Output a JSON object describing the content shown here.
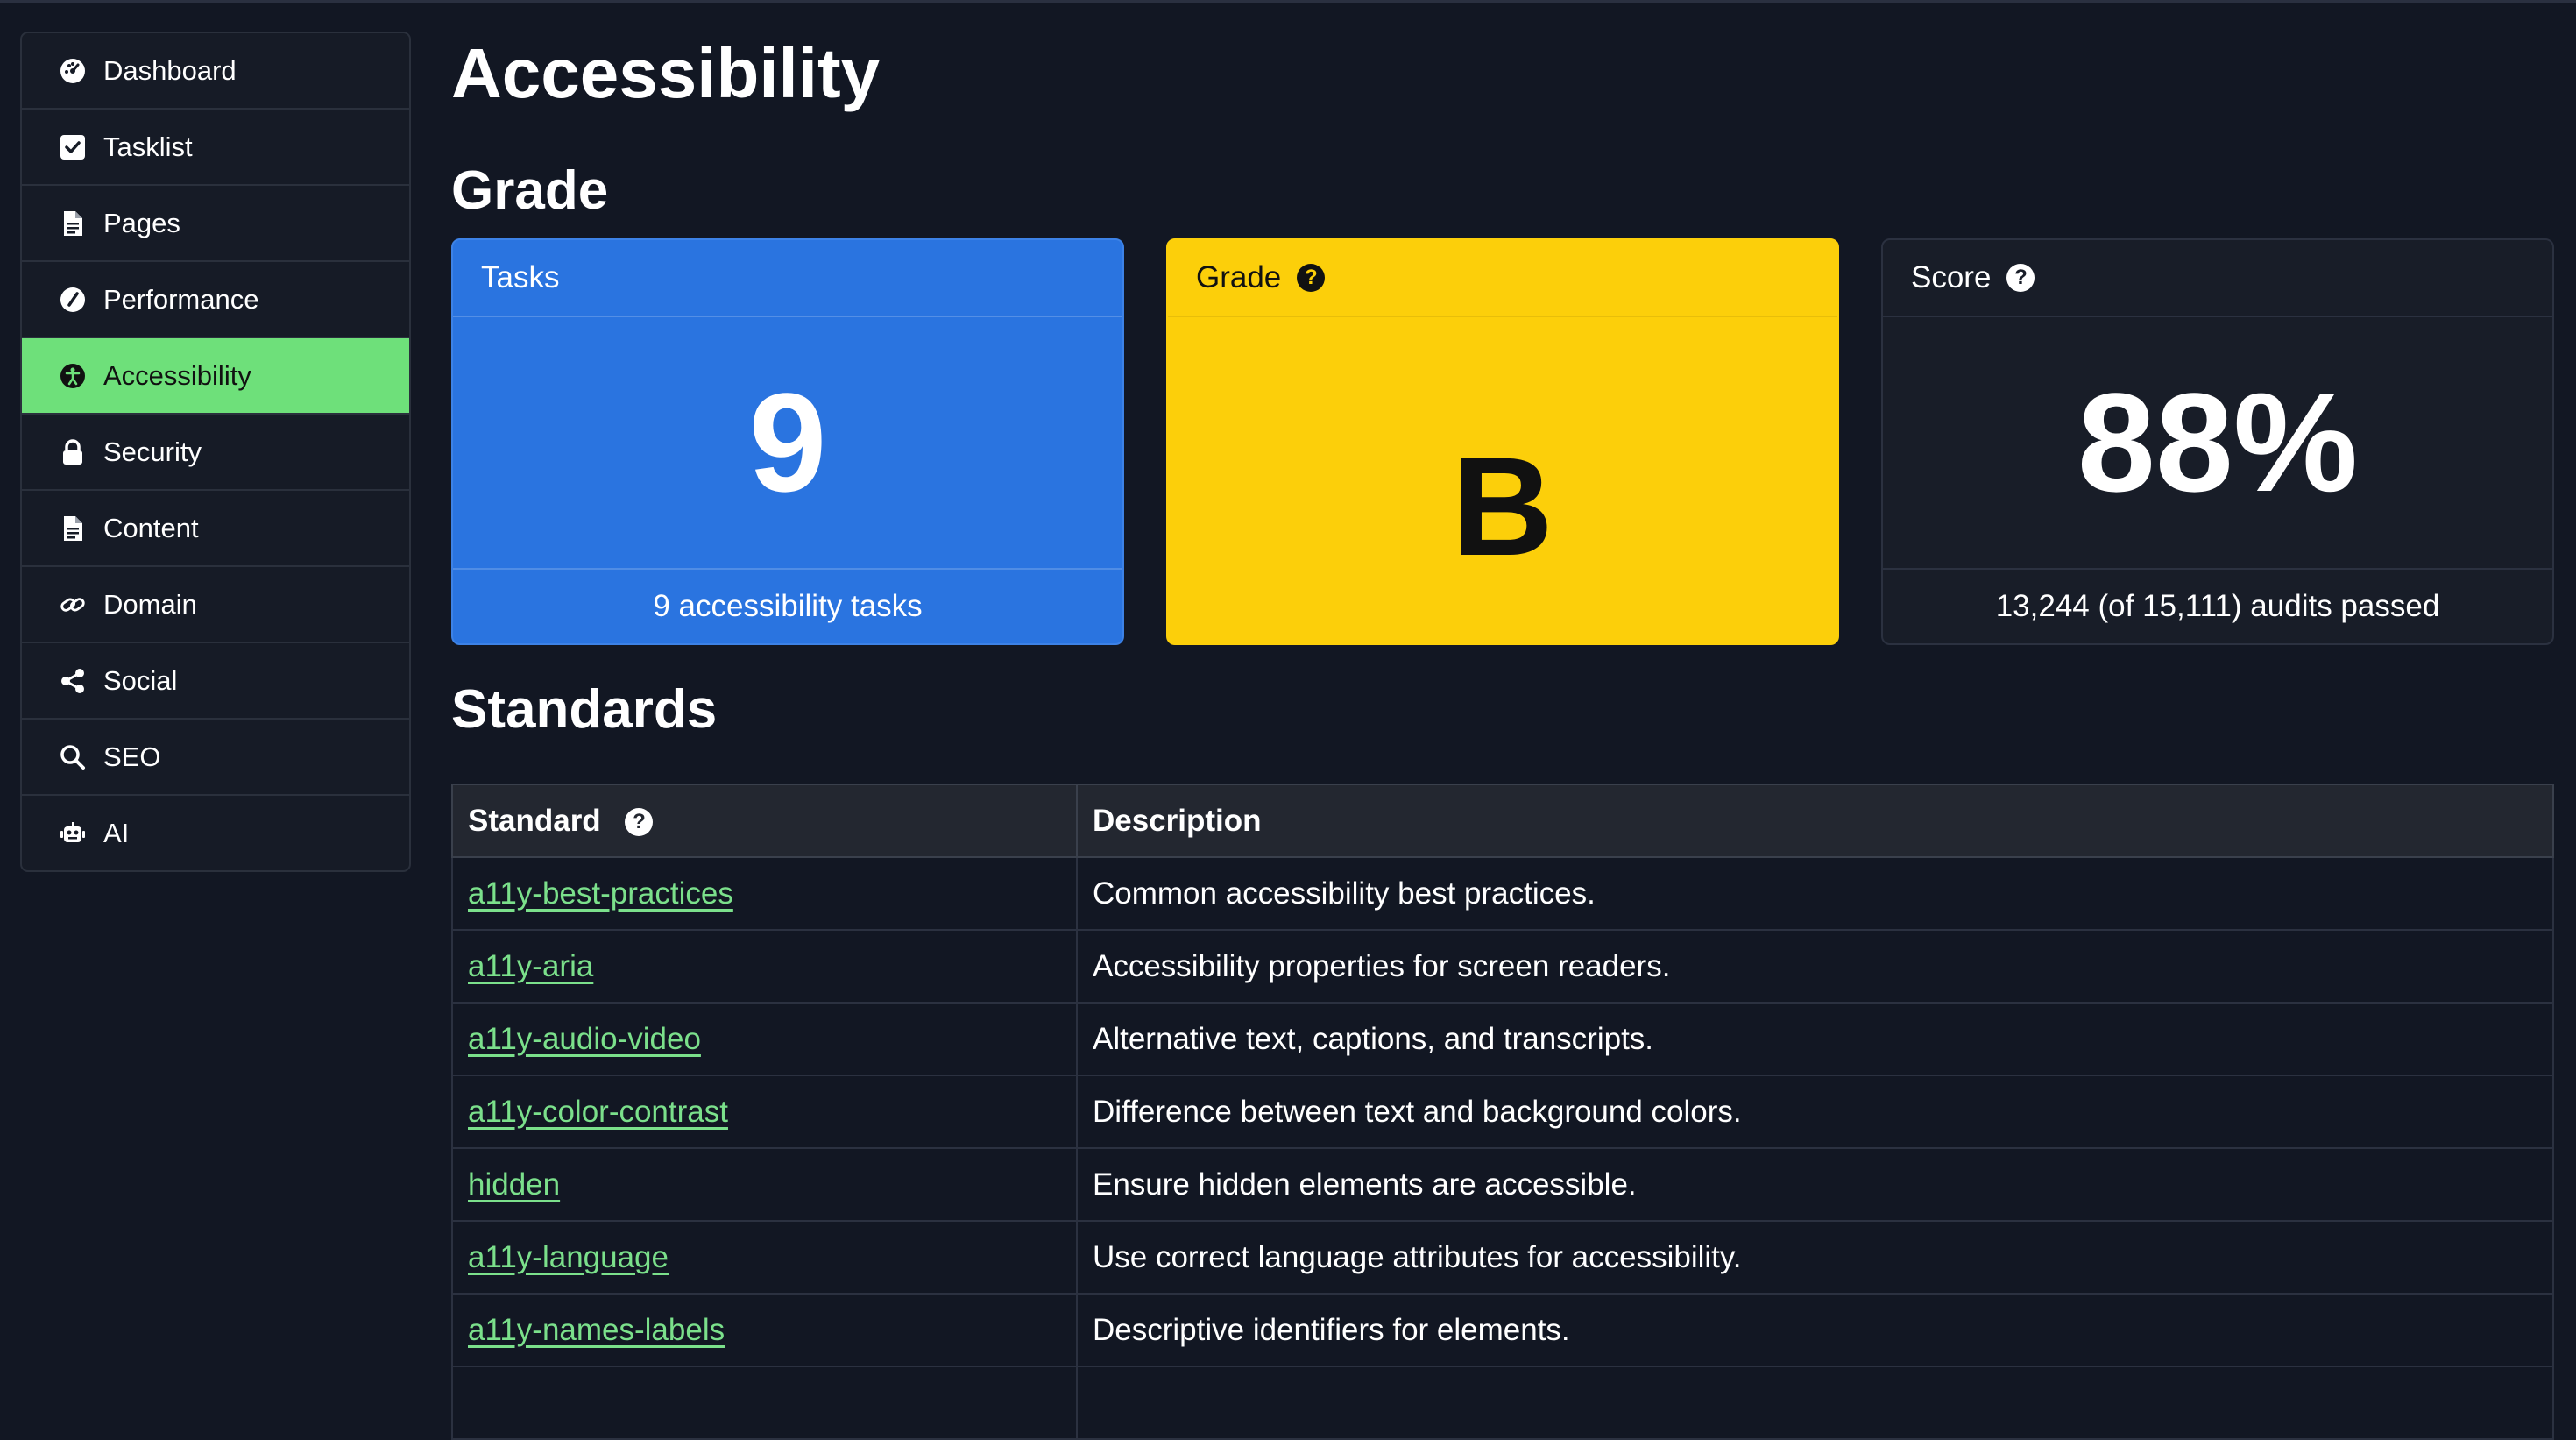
{
  "sidebar": {
    "items": [
      {
        "label": "Dashboard",
        "icon": "dashboard-icon",
        "active": false
      },
      {
        "label": "Tasklist",
        "icon": "checkbox-icon",
        "active": false
      },
      {
        "label": "Pages",
        "icon": "page-icon",
        "active": false
      },
      {
        "label": "Performance",
        "icon": "speedometer-icon",
        "active": false
      },
      {
        "label": "Accessibility",
        "icon": "accessibility-icon",
        "active": true
      },
      {
        "label": "Security",
        "icon": "lock-icon",
        "active": false
      },
      {
        "label": "Content",
        "icon": "document-icon",
        "active": false
      },
      {
        "label": "Domain",
        "icon": "link-icon",
        "active": false
      },
      {
        "label": "Social",
        "icon": "share-icon",
        "active": false
      },
      {
        "label": "SEO",
        "icon": "search-icon",
        "active": false
      },
      {
        "label": "AI",
        "icon": "robot-icon",
        "active": false
      }
    ],
    "active_color": "#6ee07a"
  },
  "main": {
    "title": "Accessibility",
    "grade_section_title": "Grade",
    "standards_section_title": "Standards",
    "cards": {
      "tasks": {
        "label": "Tasks",
        "value": "9",
        "footer": "9 accessibility tasks",
        "color": "#2a74e0"
      },
      "grade": {
        "label": "Grade",
        "help": "?",
        "value": "B",
        "color": "#fccf0a"
      },
      "score": {
        "label": "Score",
        "help": "?",
        "value": "88%",
        "footer": "13,244 (of 15,111) audits passed"
      }
    },
    "table": {
      "headers": {
        "standard": "Standard",
        "help": "?",
        "description": "Description"
      },
      "rows": [
        {
          "standard": "a11y-best-practices",
          "description": "Common accessibility best practices."
        },
        {
          "standard": "a11y-aria",
          "description": "Accessibility properties for screen readers."
        },
        {
          "standard": "a11y-audio-video",
          "description": "Alternative text, captions, and transcripts."
        },
        {
          "standard": "a11y-color-contrast",
          "description": "Difference between text and background colors."
        },
        {
          "standard": "hidden",
          "description": "Ensure hidden elements are accessible."
        },
        {
          "standard": "a11y-language",
          "description": "Use correct language attributes for accessibility."
        },
        {
          "standard": "a11y-names-labels",
          "description": "Descriptive identifiers for elements."
        },
        {
          "standard": "",
          "description": ""
        }
      ],
      "link_color": "#7be08b"
    }
  }
}
